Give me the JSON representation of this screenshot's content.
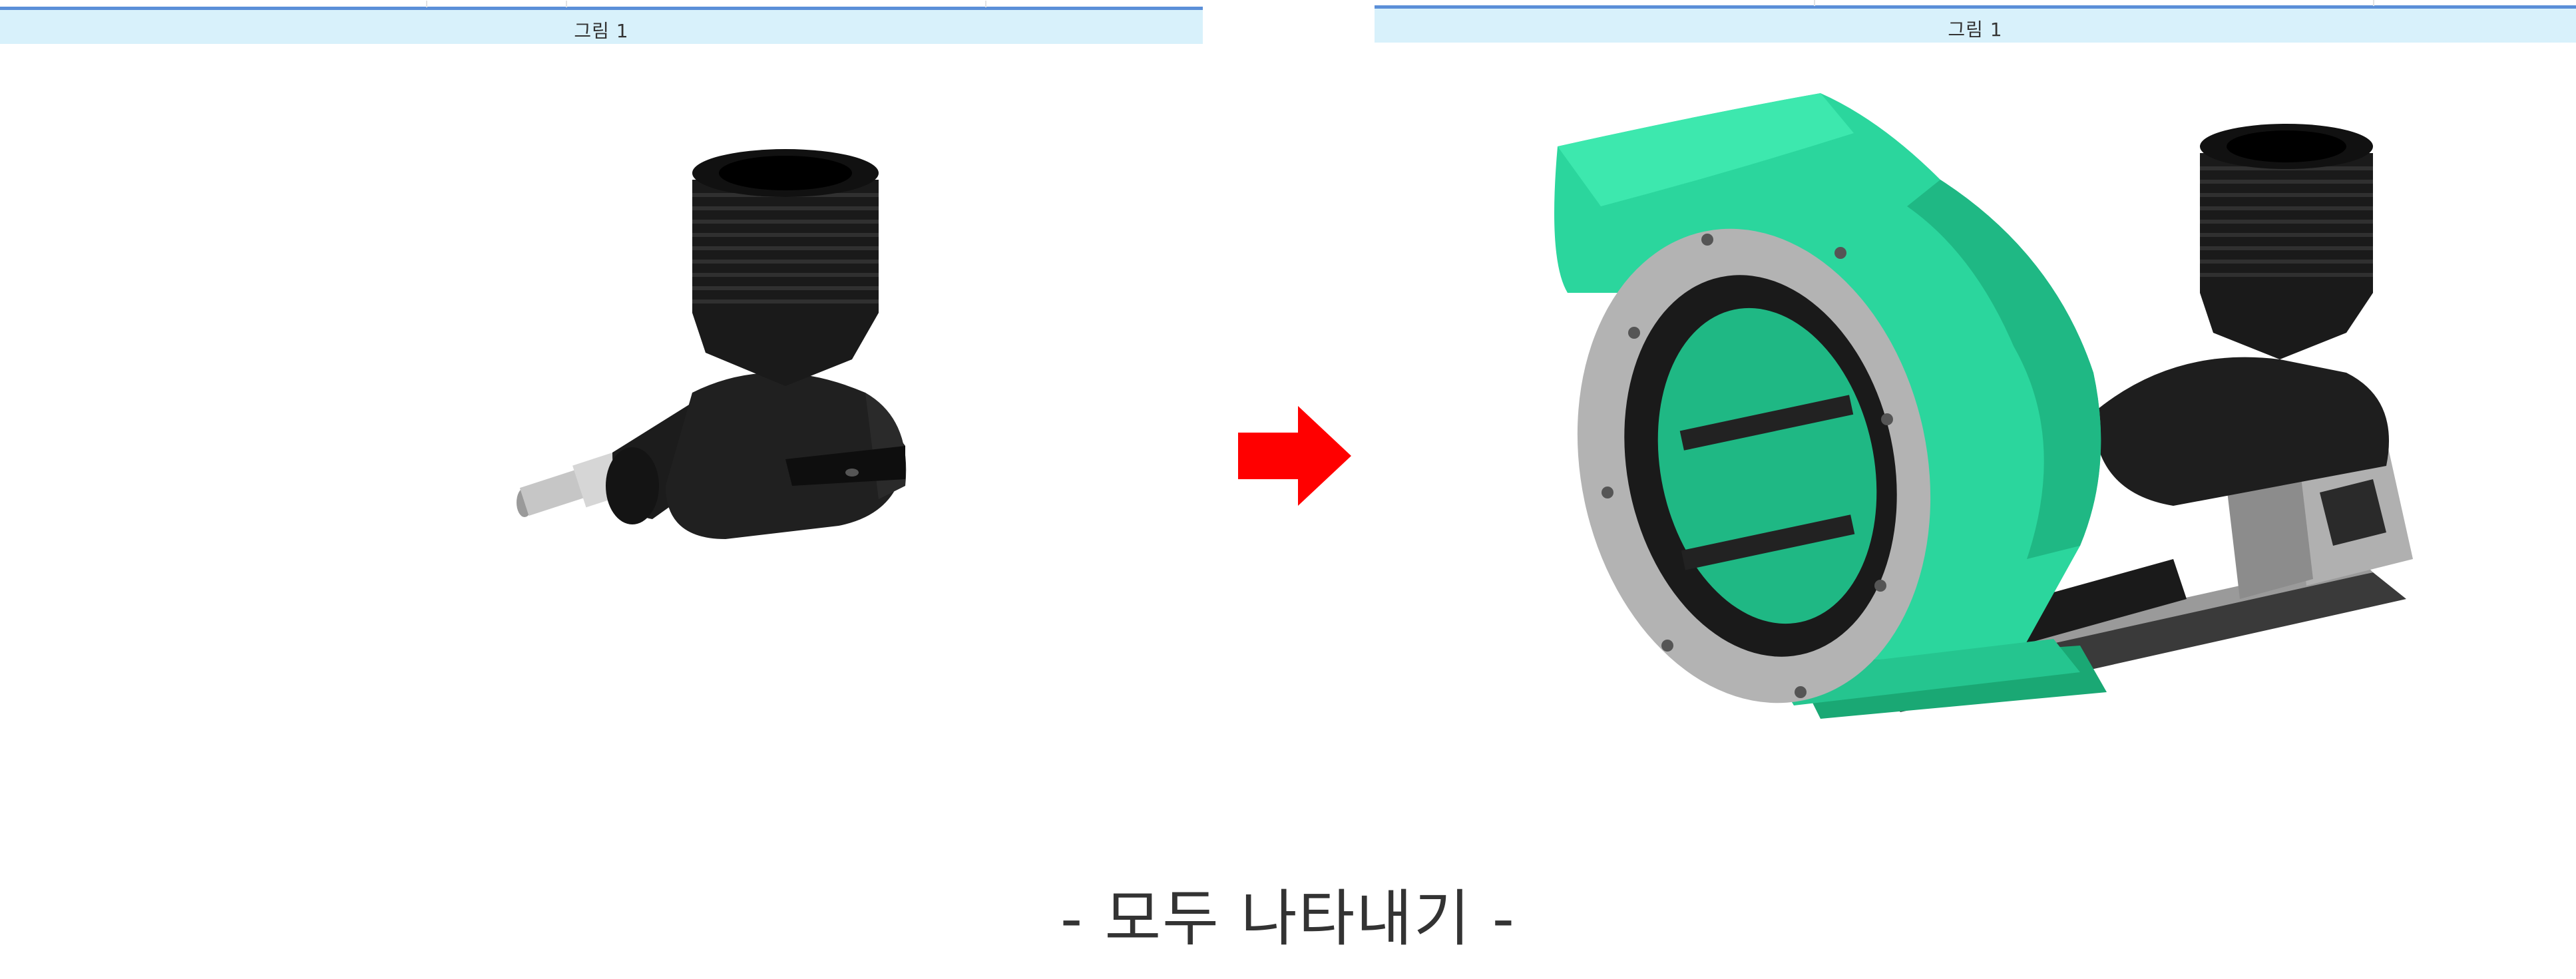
{
  "viewports": [
    {
      "label": "그림 1",
      "model_name": "engine-part-model"
    },
    {
      "label": "그림 1",
      "model_name": "full-assembly-model"
    }
  ],
  "caption": "- 모두 나타내기 -",
  "colors": {
    "header_bg": "#d8f1fb",
    "header_border": "#5b8fd8",
    "part_black": "#1c1c1c",
    "housing_green": "#2bd69d",
    "arrow_red": "#ff0000",
    "base_gray": "#a9a9a9"
  }
}
